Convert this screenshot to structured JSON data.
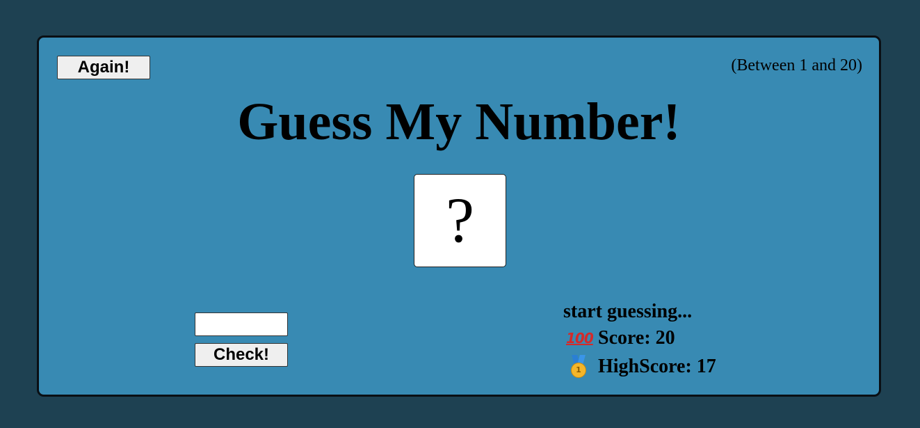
{
  "header": {
    "again_label": "Again!",
    "range_hint": "(Between 1 and 20)",
    "title": "Guess My Number!"
  },
  "secret": {
    "display": "?"
  },
  "input": {
    "value": "",
    "placeholder": ""
  },
  "controls": {
    "check_label": "Check!"
  },
  "stats": {
    "message": "start guessing...",
    "score_icon": "hundred-points-icon",
    "score_icon_glyph": "100",
    "score_label": "Score: 20",
    "highscore_icon": "first-place-medal-icon",
    "highscore_icon_glyph": "1",
    "highscore_label": "HighScore: 17"
  },
  "colors": {
    "page_background": "#1e4152",
    "card_background": "#388ab3",
    "card_border": "#0a0f14"
  }
}
